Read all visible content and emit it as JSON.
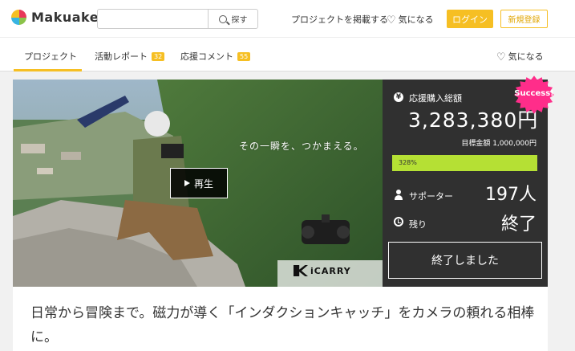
{
  "header": {
    "logo_text": "Makuake",
    "search_placeholder": "",
    "search_button": "探す",
    "post_project": "プロジェクトを掲載する",
    "favorites": "気になる",
    "login": "ログイン",
    "signup": "新規登録"
  },
  "tabs": {
    "project": "プロジェクト",
    "activity_report": "活動レポート",
    "activity_count": "32",
    "support_comments": "応援コメント",
    "comments_count": "55",
    "favorite": "気になる"
  },
  "hero": {
    "catchphrase": "その一瞬を、つかまえる。",
    "play_label": "再生",
    "brand": "iCARRY"
  },
  "panel": {
    "total_label": "応援購入総額",
    "total_amount": "3,283,380円",
    "target_label": "目標金額 1,000,000円",
    "progress_text": "328%",
    "progress_fraction": 1.0,
    "supporters_label": "サポーター",
    "supporters_value": "197人",
    "remaining_label": "残り",
    "remaining_value": "終了",
    "ended_label": "終了しました",
    "success_badge": "Success!"
  },
  "project": {
    "title": "日常から冒険まで。磁力が導く「インダクションキャッチ」をカメラの頼れる相棒に。"
  },
  "colors": {
    "accent": "#f6bf23",
    "panel_bg": "#303030",
    "progress": "#b5e034",
    "success_badge": "#ff2d8a"
  }
}
